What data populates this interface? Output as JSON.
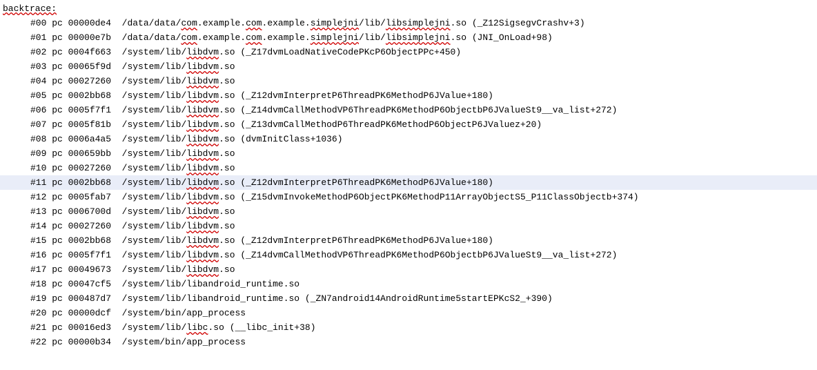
{
  "header": "backtrace:",
  "frames": [
    {
      "idx": "#00",
      "pc": "00000de4",
      "path": "/data/data/com.example.com.example.simplejni/lib/libsimplejni.so",
      "sym": "(_Z12SigsegvCrashv+3)",
      "hl": false,
      "seg": [
        "/data/data/",
        "com",
        ".example.",
        "com",
        ".example.",
        "simplejni",
        "/lib/",
        "libsimplejni",
        ".so"
      ],
      "wavy": [
        false,
        true,
        false,
        true,
        false,
        true,
        false,
        true,
        false
      ]
    },
    {
      "idx": "#01",
      "pc": "00000e7b",
      "path": "/data/data/com.example.com.example.simplejni/lib/libsimplejni.so",
      "sym": "(JNI_OnLoad+98)",
      "hl": false,
      "seg": [
        "/data/data/",
        "com",
        ".example.",
        "com",
        ".example.",
        "simplejni",
        "/lib/",
        "libsimplejni",
        ".so"
      ],
      "wavy": [
        false,
        true,
        false,
        true,
        false,
        true,
        false,
        true,
        false
      ]
    },
    {
      "idx": "#02",
      "pc": "0004f663",
      "path": "/system/lib/libdvm.so",
      "sym": "(_Z17dvmLoadNativeCodePKcP6ObjectPPc+450)",
      "hl": false,
      "seg": [
        "/system/lib/",
        "libdvm",
        ".so"
      ],
      "wavy": [
        false,
        true,
        false
      ]
    },
    {
      "idx": "#03",
      "pc": "00065f9d",
      "path": "/system/lib/libdvm.so",
      "sym": "",
      "hl": false,
      "seg": [
        "/system/lib/",
        "libdvm",
        ".so"
      ],
      "wavy": [
        false,
        true,
        false
      ]
    },
    {
      "idx": "#04",
      "pc": "00027260",
      "path": "/system/lib/libdvm.so",
      "sym": "",
      "hl": false,
      "seg": [
        "/system/lib/",
        "libdvm",
        ".so"
      ],
      "wavy": [
        false,
        true,
        false
      ]
    },
    {
      "idx": "#05",
      "pc": "0002bb68",
      "path": "/system/lib/libdvm.so",
      "sym": "(_Z12dvmInterpretP6ThreadPK6MethodP6JValue+180)",
      "hl": false,
      "seg": [
        "/system/lib/",
        "libdvm",
        ".so"
      ],
      "wavy": [
        false,
        true,
        false
      ]
    },
    {
      "idx": "#06",
      "pc": "0005f7f1",
      "path": "/system/lib/libdvm.so",
      "sym": "(_Z14dvmCallMethodVP6ThreadPK6MethodP6ObjectbP6JValueSt9__va_list+272)",
      "hl": false,
      "seg": [
        "/system/lib/",
        "libdvm",
        ".so"
      ],
      "wavy": [
        false,
        true,
        false
      ]
    },
    {
      "idx": "#07",
      "pc": "0005f81b",
      "path": "/system/lib/libdvm.so",
      "sym": "(_Z13dvmCallMethodP6ThreadPK6MethodP6ObjectP6JValuez+20)",
      "hl": false,
      "seg": [
        "/system/lib/",
        "libdvm",
        ".so"
      ],
      "wavy": [
        false,
        true,
        false
      ]
    },
    {
      "idx": "#08",
      "pc": "0006a4a5",
      "path": "/system/lib/libdvm.so",
      "sym": "(dvmInitClass+1036)",
      "hl": false,
      "seg": [
        "/system/lib/",
        "libdvm",
        ".so"
      ],
      "wavy": [
        false,
        true,
        false
      ]
    },
    {
      "idx": "#09",
      "pc": "000659bb",
      "path": "/system/lib/libdvm.so",
      "sym": "",
      "hl": false,
      "seg": [
        "/system/lib/",
        "libdvm",
        ".so"
      ],
      "wavy": [
        false,
        true,
        false
      ]
    },
    {
      "idx": "#10",
      "pc": "00027260",
      "path": "/system/lib/libdvm.so",
      "sym": "",
      "hl": false,
      "seg": [
        "/system/lib/",
        "libdvm",
        ".so"
      ],
      "wavy": [
        false,
        true,
        false
      ]
    },
    {
      "idx": "#11",
      "pc": "0002bb68",
      "path": "/system/lib/libdvm.so",
      "sym": "(_Z12dvmInterpretP6ThreadPK6MethodP6JValue+180)",
      "hl": true,
      "seg": [
        "/system/lib/",
        "libdvm",
        ".so"
      ],
      "wavy": [
        false,
        true,
        false
      ]
    },
    {
      "idx": "#12",
      "pc": "0005fab7",
      "path": "/system/lib/libdvm.so",
      "sym": "(_Z15dvmInvokeMethodP6ObjectPK6MethodP11ArrayObjectS5_P11ClassObjectb+374)",
      "hl": false,
      "seg": [
        "/system/lib/",
        "libdvm",
        ".so"
      ],
      "wavy": [
        false,
        true,
        false
      ]
    },
    {
      "idx": "#13",
      "pc": "0006700d",
      "path": "/system/lib/libdvm.so",
      "sym": "",
      "hl": false,
      "seg": [
        "/system/lib/",
        "libdvm",
        ".so"
      ],
      "wavy": [
        false,
        true,
        false
      ]
    },
    {
      "idx": "#14",
      "pc": "00027260",
      "path": "/system/lib/libdvm.so",
      "sym": "",
      "hl": false,
      "seg": [
        "/system/lib/",
        "libdvm",
        ".so"
      ],
      "wavy": [
        false,
        true,
        false
      ]
    },
    {
      "idx": "#15",
      "pc": "0002bb68",
      "path": "/system/lib/libdvm.so",
      "sym": "(_Z12dvmInterpretP6ThreadPK6MethodP6JValue+180)",
      "hl": false,
      "seg": [
        "/system/lib/",
        "libdvm",
        ".so"
      ],
      "wavy": [
        false,
        true,
        false
      ]
    },
    {
      "idx": "#16",
      "pc": "0005f7f1",
      "path": "/system/lib/libdvm.so",
      "sym": "(_Z14dvmCallMethodVP6ThreadPK6MethodP6ObjectbP6JValueSt9__va_list+272)",
      "hl": false,
      "seg": [
        "/system/lib/",
        "libdvm",
        ".so"
      ],
      "wavy": [
        false,
        true,
        false
      ]
    },
    {
      "idx": "#17",
      "pc": "00049673",
      "path": "/system/lib/libdvm.so",
      "sym": "",
      "hl": false,
      "seg": [
        "/system/lib/",
        "libdvm",
        ".so"
      ],
      "wavy": [
        false,
        true,
        false
      ]
    },
    {
      "idx": "#18",
      "pc": "00047cf5",
      "path": "/system/lib/libandroid_runtime.so",
      "sym": "",
      "hl": false,
      "seg": [
        "/system/lib/libandroid_runtime.so"
      ],
      "wavy": [
        false
      ]
    },
    {
      "idx": "#19",
      "pc": "000487d7",
      "path": "/system/lib/libandroid_runtime.so",
      "sym": "(_ZN7android14AndroidRuntime5startEPKcS2_+390)",
      "hl": false,
      "seg": [
        "/system/lib/libandroid_runtime.so"
      ],
      "wavy": [
        false
      ]
    },
    {
      "idx": "#20",
      "pc": "00000dcf",
      "path": "/system/bin/app_process",
      "sym": "",
      "hl": false,
      "seg": [
        "/system/bin/app_process"
      ],
      "wavy": [
        false
      ]
    },
    {
      "idx": "#21",
      "pc": "00016ed3",
      "path": "/system/lib/libc.so",
      "sym": "(__libc_init+38)",
      "hl": false,
      "seg": [
        "/system/lib/",
        "libc",
        ".so"
      ],
      "wavy": [
        false,
        true,
        false
      ]
    },
    {
      "idx": "#22",
      "pc": "00000b34",
      "path": "/system/bin/app_process",
      "sym": "",
      "hl": false,
      "seg": [
        "/system/bin/app_process"
      ],
      "wavy": [
        false
      ]
    }
  ]
}
